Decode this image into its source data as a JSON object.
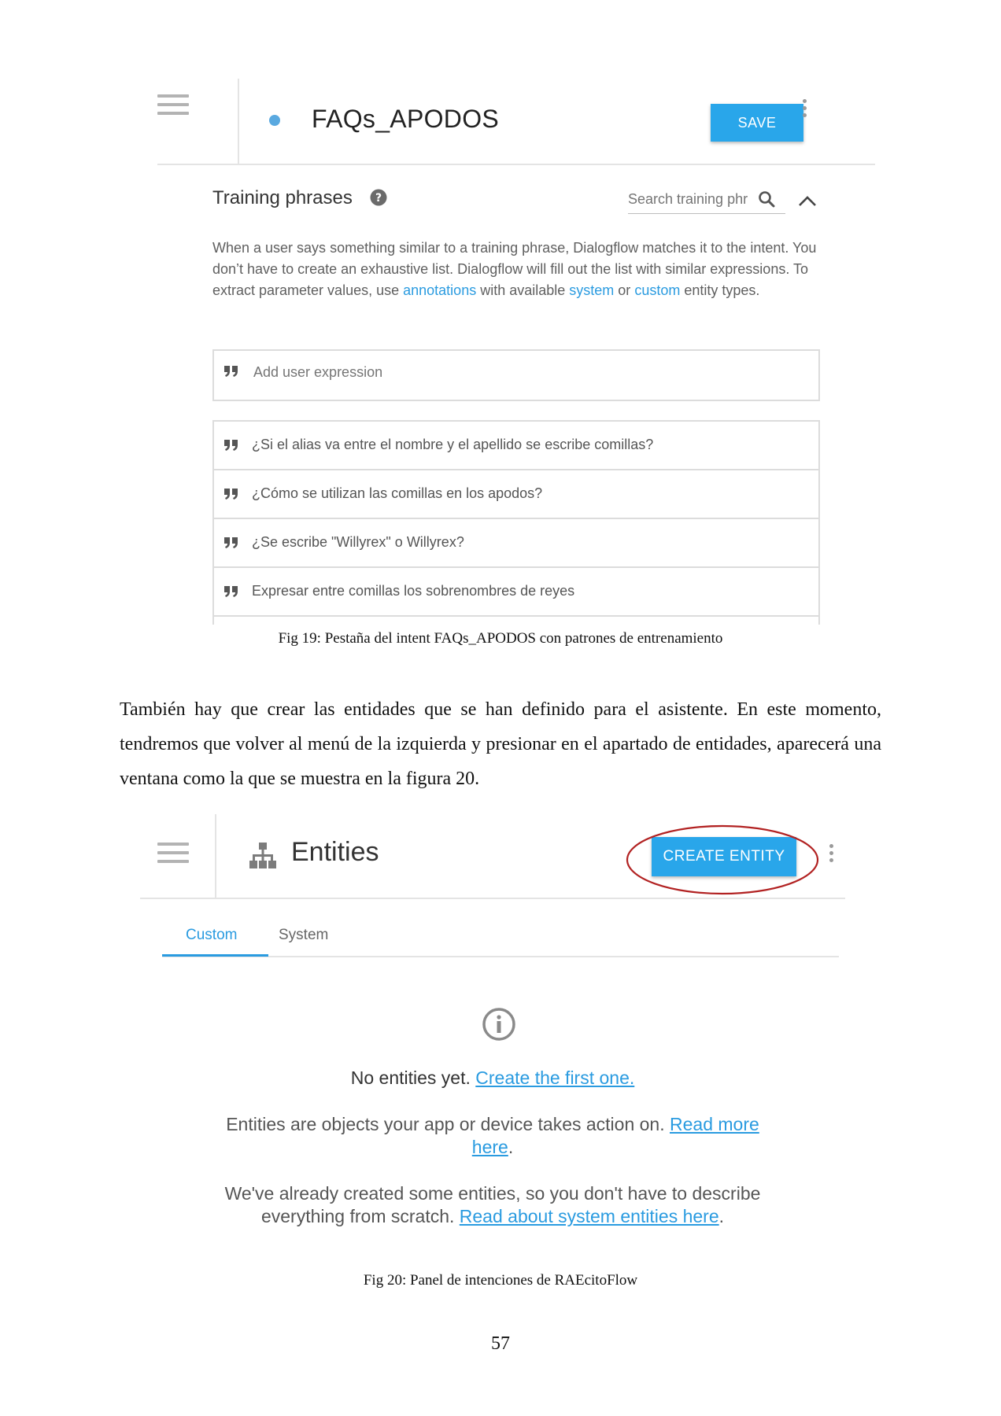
{
  "figure19": {
    "intent_title": "FAQs_APODOS",
    "save_label": "SAVE",
    "section_title": "Training phrases",
    "search_placeholder": "Search training phr",
    "description": {
      "part1": "When a user says something similar to a training phrase, Dialogflow matches it to the intent. You don’t have to create an exhaustive list. Dialogflow will fill out the list with similar expressions. To extract parameter values, use ",
      "link_annotations": "annotations",
      "part2": " with available ",
      "link_system": "system",
      "part3": " or ",
      "link_custom": "custom",
      "part4": " entity types."
    },
    "add_expression_placeholder": "Add user expression",
    "phrases": [
      "¿Si el alias va entre el nombre y el apellido se escribe comillas?",
      "¿Cómo se utilizan las comillas en los apodos?",
      "¿Se escribe \"Willyrex\" o Willyrex?",
      "Expresar entre comillas los sobrenombres de reyes"
    ],
    "caption": "Fig 19: Pestaña del intent FAQs_APODOS con patrones de entrenamiento",
    "colors": {
      "accent": "#29a6ea",
      "link": "#2a9be0",
      "dot": "#5aa9e0"
    }
  },
  "body_paragraph": "También hay que crear las entidades que se han definido para el asistente. En este momento, tendremos que volver al menú de la izquierda y presionar en el apartado de entidades, aparecerá una ventana como la que se muestra en la figura 20.",
  "figure20": {
    "title": "Entities",
    "create_label": "CREATE ENTITY",
    "tabs": [
      {
        "label": "Custom",
        "active": true
      },
      {
        "label": "System",
        "active": false
      }
    ],
    "empty_state": {
      "line1_text": "No entities yet. ",
      "line1_link": "Create the first one.",
      "line2_text": "Entities are objects your app or device takes action on. ",
      "line2_link_a": "Read more",
      "line3_link_b": "here",
      "line3_after": ".",
      "line4_text": "We've already created some entities, so you don't have to describe",
      "line5_text": "everything from scratch. ",
      "line5_link": "Read about system entities here",
      "line5_after": "."
    },
    "caption": "Fig 20: Panel de intenciones de RAEcitoFlow",
    "highlight_color": "#b22222"
  },
  "page_number": "57"
}
